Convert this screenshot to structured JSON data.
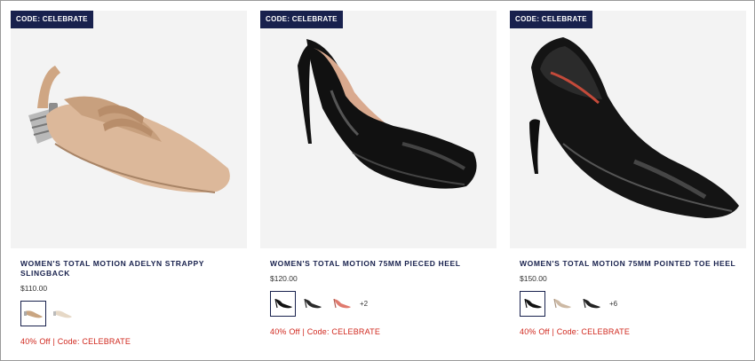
{
  "products": [
    {
      "badge": "CODE: CELEBRATE",
      "title": "WOMEN'S TOTAL MOTION ADELYN STRAPPY SLINGBACK",
      "price": "$110.00",
      "swatches": [
        "tan-slingback",
        "cream-slingback"
      ],
      "more": "",
      "promo": "40% Off | Code: CELEBRATE",
      "image_color": "#d7b496"
    },
    {
      "badge": "CODE: CELEBRATE",
      "title": "WOMEN'S TOTAL MOTION 75MM PIECED HEEL",
      "price": "$120.00",
      "swatches": [
        "black-patent-heel",
        "black-leather-heel",
        "coral-heel"
      ],
      "more": "+2",
      "promo": "40% Off | Code: CELEBRATE",
      "image_color": "#0d0d0d"
    },
    {
      "badge": "CODE: CELEBRATE",
      "title": "WOMEN'S TOTAL MOTION 75MM POINTED TOE HEEL",
      "price": "$150.00",
      "swatches": [
        "black-patent-heel",
        "nude-heel",
        "black-leather-heel"
      ],
      "more": "+6",
      "promo": "40% Off | Code: CELEBRATE",
      "image_color": "#0d0d0d"
    }
  ]
}
